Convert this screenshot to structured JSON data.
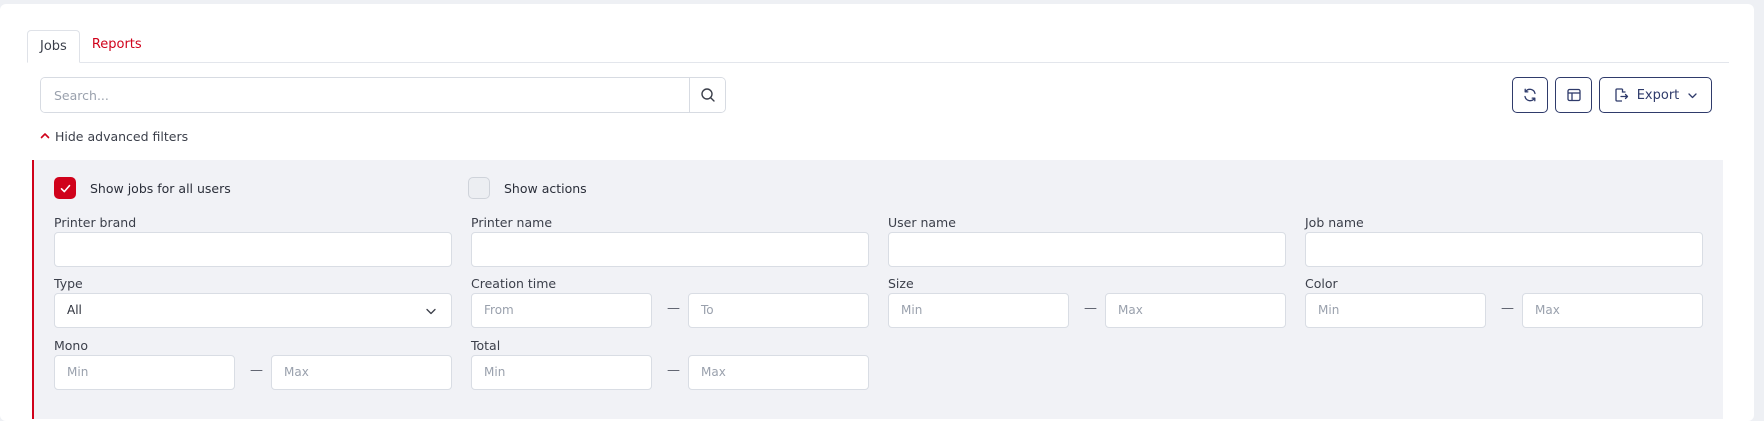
{
  "tabs": [
    {
      "label": "Jobs",
      "active": true
    },
    {
      "label": "Reports",
      "active": false
    }
  ],
  "search": {
    "placeholder": "Search..."
  },
  "toolbar": {
    "export_label": "Export"
  },
  "filters_toggle": {
    "label": "Hide advanced filters"
  },
  "filters": {
    "show_all_users": {
      "label": "Show jobs for all users",
      "checked": true
    },
    "show_actions": {
      "label": "Show actions",
      "checked": false
    },
    "printer_brand": {
      "label": "Printer brand"
    },
    "printer_name": {
      "label": "Printer name"
    },
    "user_name": {
      "label": "User name"
    },
    "job_name": {
      "label": "Job name"
    },
    "type": {
      "label": "Type",
      "value": "All"
    },
    "creation_time": {
      "label": "Creation time",
      "from_placeholder": "From",
      "to_placeholder": "To"
    },
    "size": {
      "label": "Size",
      "min_placeholder": "Min",
      "max_placeholder": "Max"
    },
    "color": {
      "label": "Color",
      "min_placeholder": "Min",
      "max_placeholder": "Max"
    },
    "mono": {
      "label": "Mono",
      "min_placeholder": "Min",
      "max_placeholder": "Max"
    },
    "total": {
      "label": "Total",
      "min_placeholder": "Min",
      "max_placeholder": "Max"
    },
    "range_separator": "—"
  },
  "colors": {
    "accent": "#d0021b",
    "navy": "#2f3b6b",
    "panel": "#f1f2f6"
  }
}
